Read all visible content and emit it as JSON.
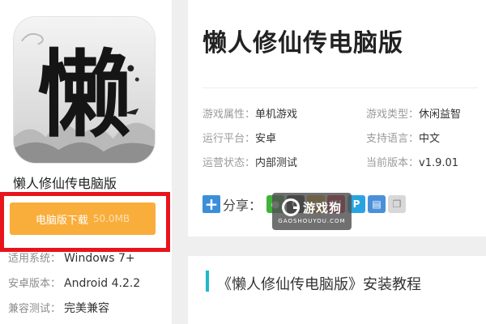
{
  "app": {
    "name": "懒人修仙传电脑版",
    "icon_glyph": "懒"
  },
  "download": {
    "label": "电脑版下载",
    "size": "50.0MB"
  },
  "specs": [
    {
      "label": "适用系统：",
      "value": "Windows 7+"
    },
    {
      "label": "安卓版本：",
      "value": "Android 4.2.2"
    },
    {
      "label": "兼容测试：",
      "value": "完美兼容"
    }
  ],
  "detail": {
    "title": "懒人修仙传电脑版",
    "info": [
      {
        "label": "游戏属性：",
        "value": "单机游戏"
      },
      {
        "label": "游戏类型：",
        "value": "休闲益智"
      },
      {
        "label": "运行平台：",
        "value": "安卓"
      },
      {
        "label": "支持语言：",
        "value": "中文"
      },
      {
        "label": "运营状态：",
        "value": "内部测试"
      },
      {
        "label": "当前版本：",
        "value": "v1.9.01"
      }
    ]
  },
  "share": {
    "label": "分享：",
    "icons": [
      "wechat-icon",
      "qq-icon",
      "qzone-icon",
      "weibo-icon",
      "tencent-weibo-icon",
      "print-icon",
      "copy-icon"
    ]
  },
  "watermark": {
    "name": "游戏狗",
    "domain": "GAOSHOUYOU.COM"
  },
  "section": {
    "title": "《懒人修仙传电脑版》安装教程"
  },
  "colors": {
    "download_button": "#f9ad3b",
    "highlight_frame": "#e8141b",
    "section_accent": "#1fb8c9",
    "share_plus": "#3b8fd9"
  }
}
